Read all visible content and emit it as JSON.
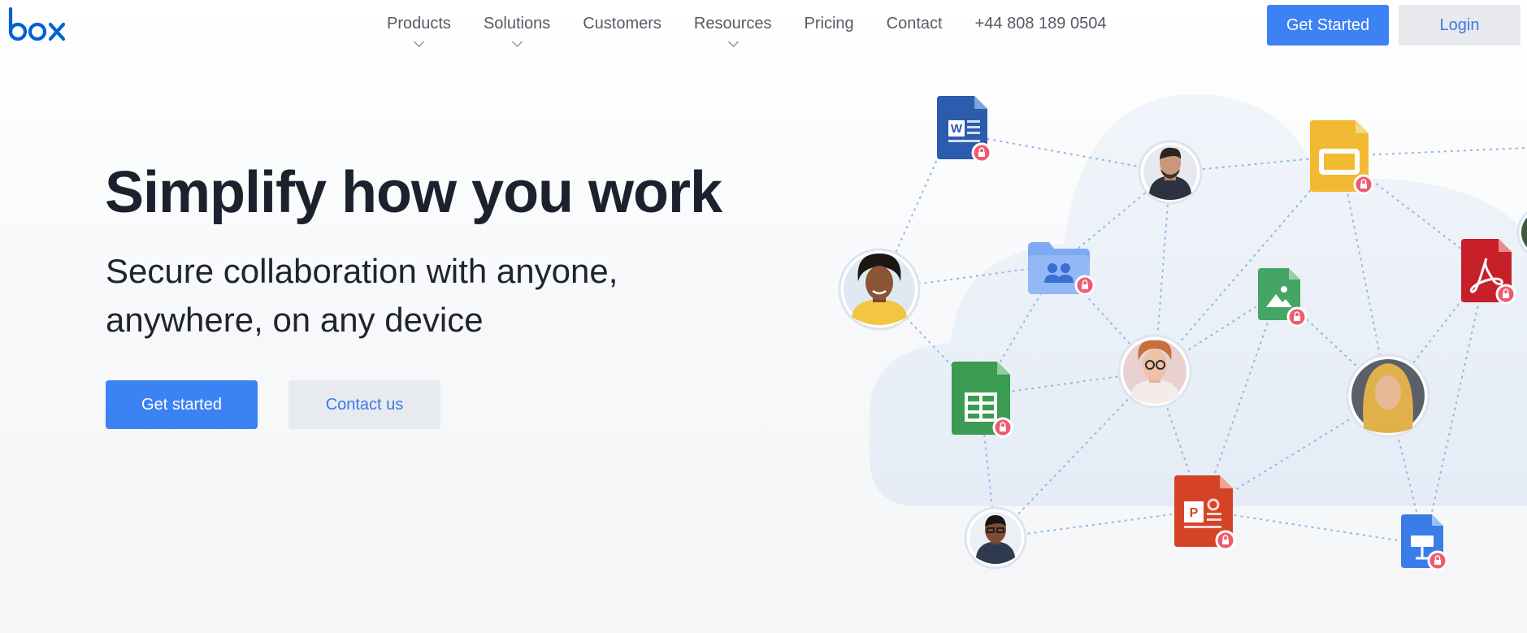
{
  "brand": {
    "logo_text": "box",
    "color": "#0061d5"
  },
  "nav": {
    "items": [
      {
        "label": "Products",
        "has_dropdown": true
      },
      {
        "label": "Solutions",
        "has_dropdown": true
      },
      {
        "label": "Customers",
        "has_dropdown": false
      },
      {
        "label": "Resources",
        "has_dropdown": true
      },
      {
        "label": "Pricing",
        "has_dropdown": false
      },
      {
        "label": "Contact",
        "has_dropdown": false
      }
    ],
    "phone": "+44 808 189 0504",
    "get_started_label": "Get Started",
    "login_label": "Login"
  },
  "hero": {
    "title": "Simplify how you work",
    "subtitle": "Secure collaboration with anyone, anywhere, on any device",
    "primary_cta": "Get started",
    "secondary_cta": "Contact us"
  },
  "illustration": {
    "icons": [
      "word-file-icon",
      "slides-file-icon",
      "pdf-file-icon",
      "shared-folder-icon",
      "image-file-icon",
      "sheets-file-icon",
      "powerpoint-file-icon",
      "keynote-file-icon",
      "lock-icon"
    ],
    "colors": {
      "accent": "#3d82f4",
      "cloud": "#e9eff7",
      "word": "#2b5cad",
      "slides": "#f2b932",
      "pdf": "#c8202a",
      "sheets": "#3a9b52",
      "ppt": "#d54326",
      "lock_badge": "#ef5b6e"
    }
  }
}
